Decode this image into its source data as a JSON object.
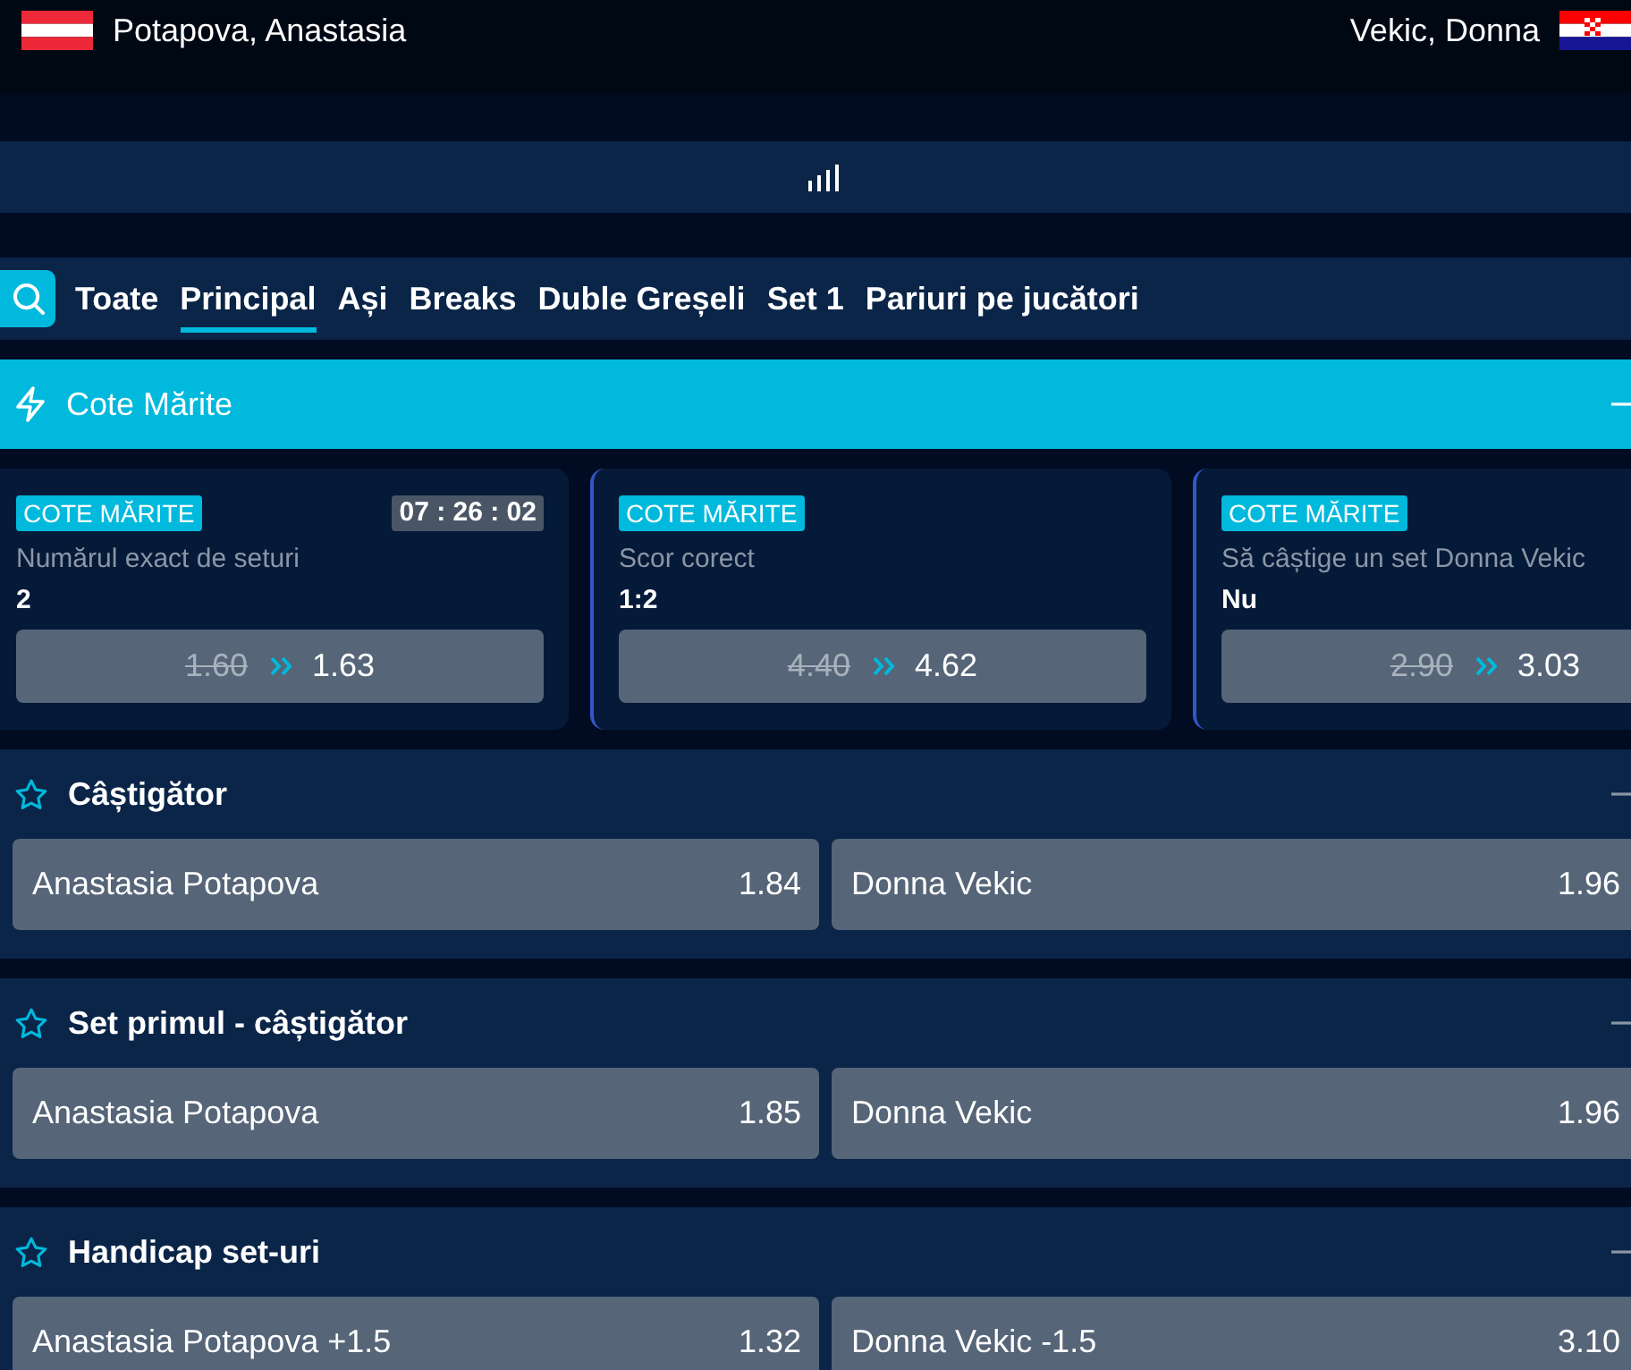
{
  "header": {
    "home_player": "Potapova, Anastasia",
    "away_player": "Vekic, Donna"
  },
  "tabs": [
    {
      "label": "Toate",
      "selected": false
    },
    {
      "label": "Principal",
      "selected": true
    },
    {
      "label": "Ași",
      "selected": false
    },
    {
      "label": "Breaks",
      "selected": false
    },
    {
      "label": "Duble Greșeli",
      "selected": false
    },
    {
      "label": "Set 1",
      "selected": false
    },
    {
      "label": "Pariuri pe jucători",
      "selected": false
    }
  ],
  "boosted": {
    "title": "Cote Mărite",
    "expanded": true,
    "cards": [
      {
        "badge": "COTE MĂRITE",
        "timer": "07 : 26 : 02",
        "market": "Numărul exact de seturi",
        "selection": "2",
        "old_odds": "1.60",
        "new_odds": "1.63"
      },
      {
        "badge": "COTE MĂRITE",
        "market": "Scor corect",
        "selection": "1:2",
        "old_odds": "4.40",
        "new_odds": "4.62"
      },
      {
        "badge": "COTE MĂRITE",
        "market": "Să câștige un set Donna Vekic",
        "selection": "Nu",
        "old_odds": "2.90",
        "new_odds": "3.03"
      }
    ]
  },
  "markets": [
    {
      "title": "Câștigător",
      "favorite": false,
      "expanded": true,
      "outcomes": [
        {
          "name": "Anastasia Potapova",
          "odds": "1.84"
        },
        {
          "name": "Donna Vekic",
          "odds": "1.96"
        }
      ]
    },
    {
      "title": "Set primul - câștigător",
      "favorite": false,
      "expanded": true,
      "outcomes": [
        {
          "name": "Anastasia Potapova",
          "odds": "1.85"
        },
        {
          "name": "Donna Vekic",
          "odds": "1.96"
        }
      ]
    },
    {
      "title": "Handicap set-uri",
      "favorite": false,
      "expanded": true,
      "outcomes": [
        {
          "name": "Anastasia Potapova +1.5",
          "odds": "1.32"
        },
        {
          "name": "Donna Vekic -1.5",
          "odds": "3.10"
        }
      ]
    }
  ]
}
